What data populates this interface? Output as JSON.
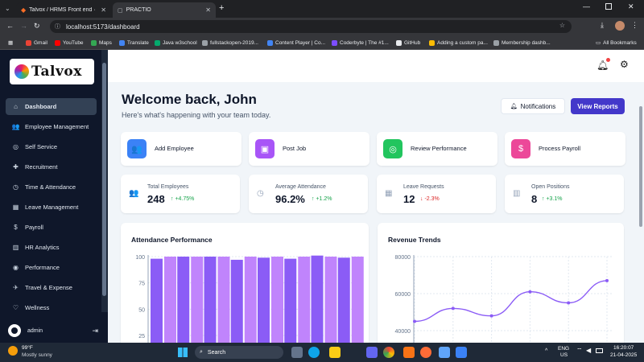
{
  "browser": {
    "tabs": [
      {
        "title": "Talvox / HRMS Front end · Git",
        "active": false
      },
      {
        "title": "PRACTIO",
        "active": true
      }
    ],
    "url": "localhost:5173/dashboard",
    "bookmarks": [
      "Gmail",
      "YouTube",
      "Maps",
      "Translate",
      "Java w3school",
      "fullstackopen-2019...",
      "Content Player | Co...",
      "Coderbyte | The #1...",
      "GitHub",
      "Adding a custom pa...",
      "Membership dashb..."
    ],
    "all_bookmarks": "All Bookmarks"
  },
  "sidebar": {
    "logo": "Talvox",
    "items": [
      {
        "label": "Dashboard",
        "icon": "home-icon",
        "glyph": "⌂",
        "active": true
      },
      {
        "label": "Employee Management",
        "icon": "users-icon",
        "glyph": "👥",
        "active": false
      },
      {
        "label": "Self Service",
        "icon": "user-circle-icon",
        "glyph": "◎",
        "active": false
      },
      {
        "label": "Recruitment",
        "icon": "user-plus-icon",
        "glyph": "✚",
        "active": false
      },
      {
        "label": "Time & Attendance",
        "icon": "clock-icon",
        "glyph": "◷",
        "active": false
      },
      {
        "label": "Leave Management",
        "icon": "calendar-icon",
        "glyph": "▦",
        "active": false
      },
      {
        "label": "Payroll",
        "icon": "dollar-icon",
        "glyph": "$",
        "active": false
      },
      {
        "label": "HR Analytics",
        "icon": "bar-chart-icon",
        "glyph": "▥",
        "active": false
      },
      {
        "label": "Performance",
        "icon": "target-icon",
        "glyph": "◉",
        "active": false
      },
      {
        "label": "Travel & Expense",
        "icon": "plane-icon",
        "glyph": "✈",
        "active": false
      },
      {
        "label": "Wellness",
        "icon": "heart-icon",
        "glyph": "♡",
        "active": false
      }
    ],
    "user": "admin"
  },
  "header": {
    "title": "Welcome back, John",
    "subtitle": "Here's what's happening with your team today.",
    "notifications_label": "Notifications",
    "view_reports_label": "View Reports"
  },
  "quick_actions": [
    {
      "label": "Add Employee",
      "icon": "users-icon",
      "glyph": "👥",
      "color": "#3b82f6"
    },
    {
      "label": "Post Job",
      "icon": "briefcase-icon",
      "glyph": "▣",
      "color": "#a855f7"
    },
    {
      "label": "Review Performance",
      "icon": "target-icon",
      "glyph": "◎",
      "color": "#22c55e"
    },
    {
      "label": "Process Payroll",
      "icon": "dollar-icon",
      "glyph": "$",
      "color": "#ec4899"
    }
  ],
  "stats": [
    {
      "label": "Total Employees",
      "value": "248",
      "change": "+4.75%",
      "direction": "up",
      "icon": "users-icon",
      "glyph": "👥"
    },
    {
      "label": "Average Attendance",
      "value": "96.2%",
      "change": "+1.2%",
      "direction": "up",
      "icon": "clock-icon",
      "glyph": "◷"
    },
    {
      "label": "Leave Requests",
      "value": "12",
      "change": "-2.3%",
      "direction": "down",
      "icon": "calendar-icon",
      "glyph": "▦"
    },
    {
      "label": "Open Positions",
      "value": "8",
      "change": "+3.1%",
      "direction": "up",
      "icon": "bar-chart-icon",
      "glyph": "▥"
    }
  ],
  "colors": {
    "up": "#16a34a",
    "down": "#dc2626",
    "accent": "#4338ca",
    "bar_dark": "#8b5cf6",
    "bar_light": "#c084fc",
    "line": "#8b5cf6"
  },
  "chart_data": [
    {
      "type": "bar",
      "title": "Attendance Performance",
      "ylim": [
        25,
        100
      ],
      "yticks": [
        25,
        50,
        75,
        100
      ],
      "series": [
        {
          "values": [
            98,
            100,
            100,
            97,
            99,
            98,
            101,
            99
          ]
        },
        {
          "values": [
            100,
            100,
            100,
            100,
            100,
            100,
            100,
            100
          ]
        }
      ]
    },
    {
      "type": "line",
      "title": "Revenue Trends",
      "ylim": [
        20000,
        80000
      ],
      "yticks": [
        40000,
        60000,
        80000
      ],
      "values": [
        45000,
        52000,
        48000,
        61000,
        55000,
        67000
      ]
    }
  ],
  "taskbar": {
    "weather_temp": "99°F",
    "weather_desc": "Mostly sunny",
    "search": "Search",
    "lang": "ENG",
    "region": "US",
    "time": "16:20:07",
    "date": "21-04-2025"
  }
}
